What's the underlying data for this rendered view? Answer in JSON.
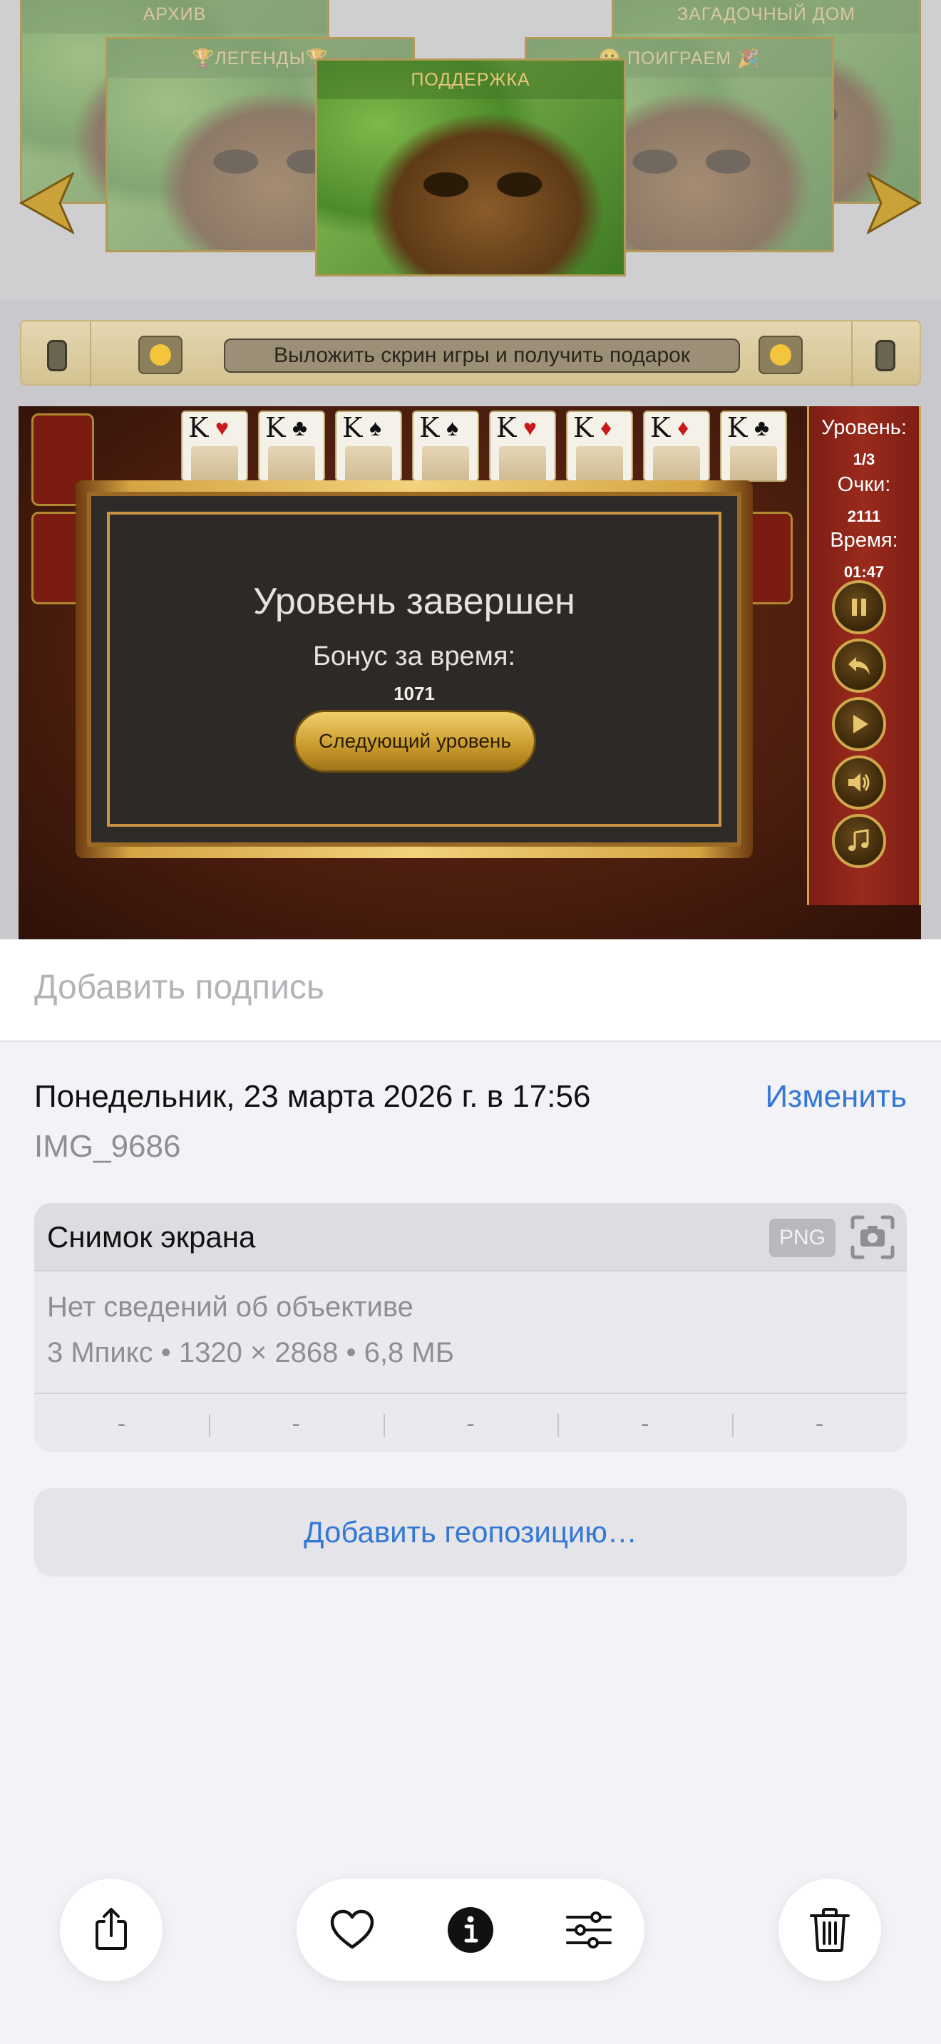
{
  "screenshot": {
    "carousel": {
      "cards": [
        {
          "title": "АРХИВ"
        },
        {
          "title": "🏆ЛЕГЕНДЫ🏆"
        },
        {
          "title": "ПОДДЕРЖКА"
        },
        {
          "title": "😀 ПОИГРАЕМ 🎉"
        },
        {
          "title": "ЗАГАДОЧНЫЙ ДОМ"
        }
      ],
      "arrow_color": "#c9a23a"
    },
    "banner": {
      "text": "Выложить скрин игры и получить подарок"
    },
    "game": {
      "cards": [
        {
          "rank": "K",
          "suit": "♥",
          "color": "red"
        },
        {
          "rank": "K",
          "suit": "♣",
          "color": "blk"
        },
        {
          "rank": "K",
          "suit": "♠",
          "color": "blk"
        },
        {
          "rank": "K",
          "suit": "♠",
          "color": "blk"
        },
        {
          "rank": "K",
          "suit": "♥",
          "color": "red"
        },
        {
          "rank": "K",
          "suit": "♦",
          "color": "red"
        },
        {
          "rank": "K",
          "suit": "♦",
          "color": "red"
        },
        {
          "rank": "K",
          "suit": "♣",
          "color": "blk"
        }
      ],
      "dialog": {
        "title": "Уровень завершен",
        "bonus_label": "Бонус за время:",
        "bonus_value": "1071",
        "next_button": "Следующий уровень"
      },
      "side": {
        "level_label": "Уровень:",
        "level_value": "1/3",
        "score_label": "Очки:",
        "score_value": "2111",
        "time_label": "Время:",
        "time_value": "01:47",
        "buttons": [
          "pause-icon",
          "undo-icon",
          "play-icon",
          "sound-icon",
          "music-icon"
        ]
      }
    }
  },
  "sheet": {
    "caption_placeholder": "Добавить подпись",
    "date": "Понедельник, 23 марта 2026 г. в 17:56",
    "edit_label": "Изменить",
    "filename": "IMG_9686",
    "info": {
      "title": "Снимок экрана",
      "format_badge": "PNG",
      "lens": "Нет сведений об объективе",
      "specs": "3 Мпикс • 1320 × 2868 • 6,8 МБ",
      "exif": [
        "-",
        "-",
        "-",
        "-",
        "-"
      ]
    },
    "add_location": "Добавить геопозицию…"
  },
  "toolbar": {
    "icons": [
      "share-icon",
      "heart-icon",
      "info-icon",
      "adjust-icon",
      "trash-icon"
    ]
  },
  "colors": {
    "accent": "#3478d6",
    "sheet_bg": "#f2f2f7"
  }
}
